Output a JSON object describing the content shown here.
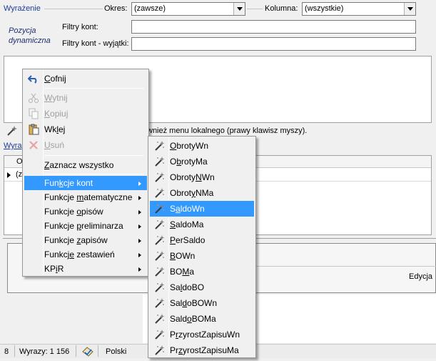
{
  "form": {
    "expression_label": "Wyrażenie",
    "okres_label": "Okres:",
    "okres_value": "(zawsze)",
    "kolumna_label": "Kolumna:",
    "kolumna_value": "(wszystkie)",
    "pozycja_line1": "Pozycja",
    "pozycja_line2": "dynamiczna",
    "filtry_label": "Filtry kont:",
    "filtry_wyjatki_label": "Filtry kont - wyjątki:"
  },
  "hint_text": "wnież menu lokalnego (prawy klawisz myszy).",
  "wyr_tab": "Wyra",
  "grid": {
    "header_fragment": "O",
    "row_fragment": "(z"
  },
  "edycja_label": "Edycja",
  "status": {
    "wyrazy": "Wyrazy: 1 156",
    "language": "Polski"
  },
  "context_menu": {
    "items": [
      {
        "label": "Cofnij",
        "u": "C",
        "icon": "undo-icon",
        "enabled": true
      },
      {
        "label": "Wytnij",
        "u": "W",
        "icon": "cut-icon",
        "enabled": false
      },
      {
        "label": "Kopiuj",
        "u": "K",
        "icon": "copy-icon",
        "enabled": false
      },
      {
        "label": "Wklej",
        "u": "l",
        "icon": "paste-icon",
        "enabled": true
      },
      {
        "label": "Usuń",
        "u": "U",
        "icon": "delete-icon",
        "enabled": false
      },
      {
        "label": "Zaznacz wszystko",
        "u": "Z",
        "enabled": true
      },
      {
        "label": "Funkcje kont",
        "u": "k",
        "submenu": true,
        "highlighted": true
      },
      {
        "label": "Funkcje matematyczne",
        "u": "m",
        "submenu": true
      },
      {
        "label": "Funkcje opisów",
        "u": "o",
        "submenu": true
      },
      {
        "label": "Funkcje preliminarza",
        "u": "p",
        "submenu": true
      },
      {
        "label": "Funkcje zapisów",
        "u": "z",
        "submenu": true
      },
      {
        "label": "Funkcje zestawień",
        "u": "e",
        "submenu": true
      },
      {
        "label": "KPiR",
        "u": "i",
        "submenu": true
      }
    ]
  },
  "submenu": {
    "items": [
      {
        "label": "ObrotyWn",
        "u": "O"
      },
      {
        "label": "ObrotyMa",
        "u": "b"
      },
      {
        "label": "ObrotyNWn",
        "u": "N"
      },
      {
        "label": "ObrotyNMa",
        "u": "y"
      },
      {
        "label": "SaldoWn",
        "u": "a",
        "highlighted": true
      },
      {
        "label": "SaldoMa",
        "u": "S"
      },
      {
        "label": "PerSaldo",
        "u": "P"
      },
      {
        "label": "BOWn",
        "u": "B"
      },
      {
        "label": "BOMa",
        "u": "M"
      },
      {
        "label": "SaldoBO",
        "u": "l"
      },
      {
        "label": "SaldoBOWn",
        "u": "d"
      },
      {
        "label": "SaldoBOMa",
        "u": "o"
      },
      {
        "label": "PrzyrostZapisuWn",
        "u": "r"
      },
      {
        "label": "PrzyrostZapisuMa",
        "u": "z"
      }
    ]
  },
  "colors": {
    "highlight": "#3399ff",
    "accent_text": "#1c3c9c"
  }
}
